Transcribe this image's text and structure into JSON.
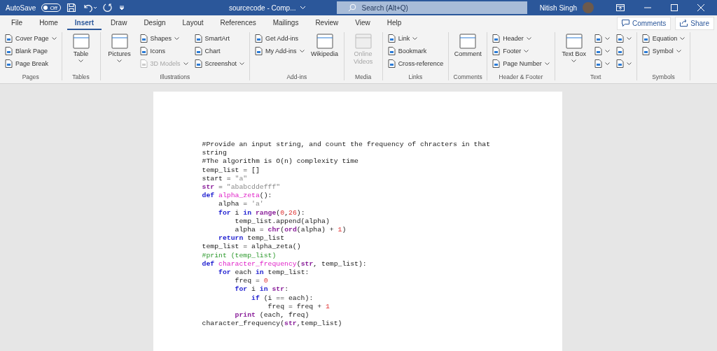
{
  "title_bar": {
    "autosave_label": "AutoSave",
    "autosave_toggle": {
      "label": "Off",
      "on": false
    },
    "document_title": "sourcecode - Comp...",
    "search": {
      "placeholder": "Search (Alt+Q)"
    },
    "user_name": "Nitish Singh"
  },
  "tabs": [
    {
      "label": "File",
      "selected": false
    },
    {
      "label": "Home",
      "selected": false
    },
    {
      "label": "Insert",
      "selected": true
    },
    {
      "label": "Draw",
      "selected": false
    },
    {
      "label": "Design",
      "selected": false
    },
    {
      "label": "Layout",
      "selected": false
    },
    {
      "label": "References",
      "selected": false
    },
    {
      "label": "Mailings",
      "selected": false
    },
    {
      "label": "Review",
      "selected": false
    },
    {
      "label": "View",
      "selected": false
    },
    {
      "label": "Help",
      "selected": false
    }
  ],
  "ribbon_actions": [
    "Comments",
    "Share"
  ],
  "ribbon_groups": [
    {
      "label": "Pages",
      "columns": [
        {
          "kind": "stack",
          "items": [
            {
              "label": "Cover Page",
              "caret": true,
              "disabled": false
            },
            {
              "label": "Blank Page",
              "caret": false,
              "disabled": false
            },
            {
              "label": "Page Break",
              "caret": false,
              "disabled": false
            }
          ]
        }
      ]
    },
    {
      "label": "Tables",
      "columns": [
        {
          "kind": "large",
          "items": [
            {
              "label": "Table",
              "caret": true,
              "disabled": false
            }
          ]
        }
      ]
    },
    {
      "label": "Illustrations",
      "columns": [
        {
          "kind": "large",
          "items": [
            {
              "label": "Pictures",
              "caret": true,
              "disabled": false
            }
          ]
        },
        {
          "kind": "stack",
          "items": [
            {
              "label": "Shapes",
              "caret": true,
              "disabled": false
            },
            {
              "label": "Icons",
              "caret": false,
              "disabled": false
            },
            {
              "label": "3D Models",
              "caret": true,
              "disabled": true
            }
          ]
        },
        {
          "kind": "stack",
          "items": [
            {
              "label": "SmartArt",
              "caret": false,
              "disabled": false
            },
            {
              "label": "Chart",
              "caret": false,
              "disabled": false
            },
            {
              "label": "Screenshot",
              "caret": true,
              "disabled": false
            }
          ]
        }
      ]
    },
    {
      "label": "Add-ins",
      "columns": [
        {
          "kind": "stack",
          "items": [
            {
              "label": "Get Add-ins",
              "caret": false,
              "disabled": false
            },
            {
              "label": "My Add-ins",
              "caret": true,
              "disabled": false
            }
          ]
        },
        {
          "kind": "large",
          "items": [
            {
              "label": "Wikipedia",
              "caret": false,
              "disabled": false
            }
          ]
        }
      ]
    },
    {
      "label": "Media",
      "columns": [
        {
          "kind": "large",
          "items": [
            {
              "label": "Online Videos",
              "caret": false,
              "disabled": true
            }
          ]
        }
      ]
    },
    {
      "label": "Links",
      "columns": [
        {
          "kind": "stack",
          "items": [
            {
              "label": "Link",
              "caret": true,
              "disabled": false
            },
            {
              "label": "Bookmark",
              "caret": false,
              "disabled": false
            },
            {
              "label": "Cross-reference",
              "caret": false,
              "disabled": false
            }
          ]
        }
      ]
    },
    {
      "label": "Comments",
      "columns": [
        {
          "kind": "large",
          "items": [
            {
              "label": "Comment",
              "caret": false,
              "disabled": false
            }
          ]
        }
      ]
    },
    {
      "label": "Header & Footer",
      "columns": [
        {
          "kind": "stack",
          "items": [
            {
              "label": "Header",
              "caret": true,
              "disabled": false
            },
            {
              "label": "Footer",
              "caret": true,
              "disabled": false
            },
            {
              "label": "Page Number",
              "caret": true,
              "disabled": false
            }
          ]
        }
      ]
    },
    {
      "label": "Text",
      "columns": [
        {
          "kind": "large",
          "items": [
            {
              "label": "Text Box",
              "caret": true,
              "disabled": false
            }
          ]
        },
        {
          "kind": "stack",
          "items": [
            {
              "caret": true,
              "disabled": false
            },
            {
              "caret": true,
              "disabled": false
            },
            {
              "caret": true,
              "disabled": false
            }
          ]
        },
        {
          "kind": "stack",
          "items": [
            {
              "caret": true,
              "disabled": false
            },
            {
              "caret": false,
              "disabled": false
            },
            {
              "caret": true,
              "disabled": false
            }
          ]
        }
      ]
    },
    {
      "label": "Symbols",
      "columns": [
        {
          "kind": "stack",
          "items": [
            {
              "label": "Equation",
              "caret": true,
              "disabled": false
            },
            {
              "label": "Symbol",
              "caret": true,
              "disabled": false
            }
          ]
        }
      ]
    }
  ],
  "document_lines": [
    {
      "tokens": [
        {
          "text": "#Provide an input string, and count the frequency of chracters in that string",
          "kind": "plain"
        }
      ]
    },
    {
      "tokens": [
        {
          "text": "#The algorithm is O(n) complexity time",
          "kind": "plain"
        }
      ]
    },
    {
      "tokens": [
        {
          "text": "temp_list = []",
          "kind": "plain"
        }
      ]
    },
    {
      "tokens": [
        {
          "text": "start = ",
          "kind": "plain"
        },
        {
          "text": "\"a\"",
          "kind": "string"
        }
      ]
    },
    {
      "tokens": [
        {
          "text": "str",
          "kind": "builtin"
        },
        {
          "text": " = ",
          "kind": "plain"
        },
        {
          "text": "\"ababcddefff\"",
          "kind": "string"
        }
      ]
    },
    {
      "tokens": [
        {
          "text": "def ",
          "kind": "keyword"
        },
        {
          "text": "alpha_zeta",
          "kind": "function"
        },
        {
          "text": "():",
          "kind": "plain"
        }
      ]
    },
    {
      "tokens": [
        {
          "text": "    alpha = ",
          "kind": "plain"
        },
        {
          "text": "'a'",
          "kind": "string"
        }
      ]
    },
    {
      "tokens": [
        {
          "text": "    for",
          "kind": "keyword"
        },
        {
          "text": " i ",
          "kind": "plain"
        },
        {
          "text": "in",
          "kind": "keyword"
        },
        {
          "text": " range",
          "kind": "builtin"
        },
        {
          "text": "(",
          "kind": "plain"
        },
        {
          "text": "0",
          "kind": "number"
        },
        {
          "text": ",",
          "kind": "plain"
        },
        {
          "text": "26",
          "kind": "number"
        },
        {
          "text": "):",
          "kind": "plain"
        }
      ]
    },
    {
      "tokens": [
        {
          "text": "        temp_list.append(alpha)",
          "kind": "plain"
        }
      ]
    },
    {
      "tokens": [
        {
          "text": "        alpha = ",
          "kind": "plain"
        },
        {
          "text": "chr",
          "kind": "builtin"
        },
        {
          "text": "(",
          "kind": "plain"
        },
        {
          "text": "ord",
          "kind": "builtin"
        },
        {
          "text": "(alpha) + ",
          "kind": "plain"
        },
        {
          "text": "1",
          "kind": "number"
        },
        {
          "text": ")",
          "kind": "plain"
        }
      ]
    },
    {
      "tokens": [
        {
          "text": "    return",
          "kind": "keyword"
        },
        {
          "text": " temp_list",
          "kind": "plain"
        }
      ]
    },
    {
      "tokens": [
        {
          "text": "temp_list = alpha_zeta()",
          "kind": "plain"
        }
      ]
    },
    {
      "tokens": [
        {
          "text": "#print (temp_list)",
          "kind": "comment"
        }
      ]
    },
    {
      "tokens": [
        {
          "text": "def ",
          "kind": "keyword"
        },
        {
          "text": "character_frequency",
          "kind": "function"
        },
        {
          "text": "(",
          "kind": "plain"
        },
        {
          "text": "str",
          "kind": "builtin"
        },
        {
          "text": ", temp_list):",
          "kind": "plain"
        }
      ]
    },
    {
      "tokens": [
        {
          "text": "    for",
          "kind": "keyword"
        },
        {
          "text": " each ",
          "kind": "plain"
        },
        {
          "text": "in",
          "kind": "keyword"
        },
        {
          "text": " temp_list:",
          "kind": "plain"
        }
      ]
    },
    {
      "tokens": [
        {
          "text": "        freq = ",
          "kind": "plain"
        },
        {
          "text": "0",
          "kind": "number"
        }
      ]
    },
    {
      "tokens": [
        {
          "text": "        for",
          "kind": "keyword"
        },
        {
          "text": " i ",
          "kind": "plain"
        },
        {
          "text": "in",
          "kind": "keyword"
        },
        {
          "text": " str",
          "kind": "builtin"
        },
        {
          "text": ":",
          "kind": "plain"
        }
      ]
    },
    {
      "tokens": [
        {
          "text": "            if",
          "kind": "keyword"
        },
        {
          "text": " (i == each):",
          "kind": "plain"
        }
      ]
    },
    {
      "tokens": [
        {
          "text": "                freq = freq + ",
          "kind": "plain"
        },
        {
          "text": "1",
          "kind": "number"
        }
      ]
    },
    {
      "tokens": [
        {
          "text": "        print",
          "kind": "builtin"
        },
        {
          "text": " (each, freq)",
          "kind": "plain"
        }
      ]
    },
    {
      "tokens": [
        {
          "text": "character_frequency(",
          "kind": "plain"
        },
        {
          "text": "str",
          "kind": "builtin"
        },
        {
          "text": ",temp_list)",
          "kind": "plain"
        }
      ]
    }
  ]
}
